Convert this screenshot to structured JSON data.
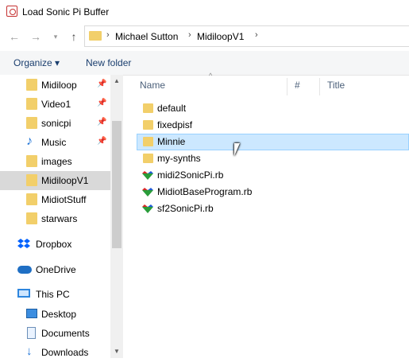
{
  "window": {
    "title": "Load Sonic Pi Buffer"
  },
  "address_bar": {
    "segments": [
      "Michael Sutton",
      "MidiloopV1"
    ]
  },
  "commands": {
    "organize": "Organize ▾",
    "new_folder": "New folder"
  },
  "columns": {
    "name": "Name",
    "number": "#",
    "title": "Title"
  },
  "sidebar": {
    "quick_access": [
      {
        "label": "Midiloop",
        "pinned": true
      },
      {
        "label": "Video1",
        "pinned": true
      },
      {
        "label": "sonicpi",
        "pinned": true
      },
      {
        "label": "Music",
        "pinned": true,
        "icon": "music-icon"
      },
      {
        "label": "images",
        "pinned": false
      },
      {
        "label": "MidiloopV1",
        "pinned": false,
        "selected": true
      },
      {
        "label": "MidiotStuff",
        "pinned": false
      },
      {
        "label": "starwars",
        "pinned": false
      }
    ],
    "dropbox": "Dropbox",
    "onedrive": "OneDrive",
    "this_pc": "This PC",
    "pc_items": [
      "Desktop",
      "Documents",
      "Downloads"
    ]
  },
  "files": [
    {
      "name": "default",
      "type": "folder"
    },
    {
      "name": "fixedpisf",
      "type": "folder"
    },
    {
      "name": "Minnie",
      "type": "folder",
      "hover": true
    },
    {
      "name": "my-synths",
      "type": "folder"
    },
    {
      "name": "midi2SonicPi.rb",
      "type": "ruby"
    },
    {
      "name": "MidiotBaseProgram.rb",
      "type": "ruby"
    },
    {
      "name": "sf2SonicPi.rb",
      "type": "ruby"
    }
  ],
  "colors": {
    "folder": "#f2cf6a",
    "hover_bg": "#cce8ff",
    "selected_bg": "#d9d9d9",
    "accent": "#1e73d6"
  }
}
